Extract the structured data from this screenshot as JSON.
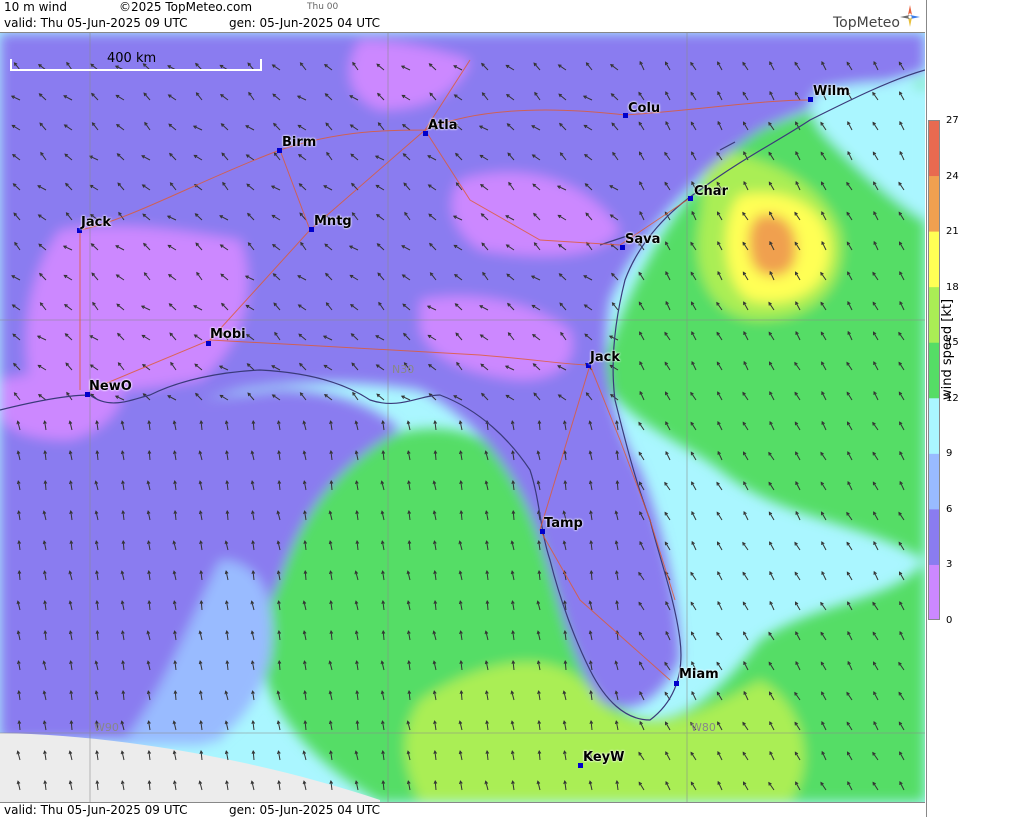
{
  "header": {
    "param": "10 m wind",
    "copyright": "©2025 TopMeteo.com",
    "tag": "Thu 00",
    "valid": "valid:  Thu  05-Jun-2025  09 UTC",
    "gen": "gen: 05-Jun-2025 04 UTC",
    "logo": "TopMeteo"
  },
  "footer": {
    "valid": "valid:  Thu  05-Jun-2025  09 UTC",
    "gen": "gen: 05-Jun-2025 04 UTC"
  },
  "map": {
    "scale_label": "400 km",
    "gridlabels": [
      "N30",
      "W90",
      "W80"
    ],
    "cities": [
      "Wilm",
      "Colu",
      "Atla",
      "Birm",
      "Char",
      "Jack",
      "Mntg",
      "Sava",
      "Mobi",
      "Jack",
      "NewO",
      "Tamp",
      "Miam",
      "KeyW"
    ]
  },
  "legend": {
    "unit": "wind speed [kt]",
    "ticks": [
      "27",
      "24",
      "21",
      "18",
      "15",
      "12",
      "9",
      "6",
      "3",
      "0"
    ],
    "colors": [
      "#cc88ff",
      "#8a7cf0",
      "#99bbff",
      "#aaf6ff",
      "#55dd66",
      "#aaee55",
      "#ffff55",
      "#f0a050",
      "#e86a50"
    ]
  }
}
